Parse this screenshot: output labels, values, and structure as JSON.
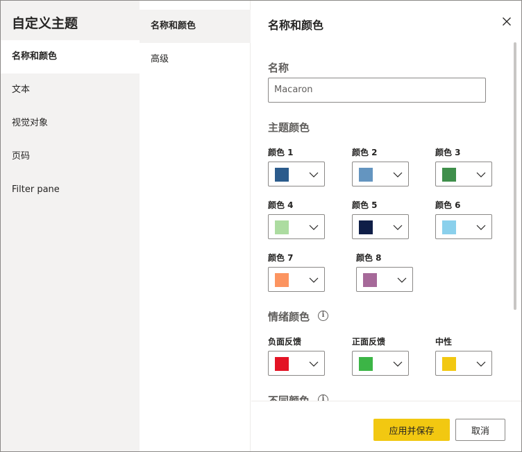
{
  "left_nav": {
    "title": "自定义主题",
    "items": [
      {
        "label": "名称和颜色",
        "active": true
      },
      {
        "label": "文本",
        "active": false
      },
      {
        "label": "视觉对象",
        "active": false
      },
      {
        "label": "页码",
        "active": false
      },
      {
        "label": "Filter pane",
        "active": false
      }
    ]
  },
  "sub_nav": {
    "items": [
      {
        "label": "名称和颜色",
        "active": true
      },
      {
        "label": "高级",
        "active": false
      }
    ]
  },
  "panel": {
    "title": "名称和颜色",
    "close_icon": "close-icon",
    "name_section": {
      "label": "名称",
      "value": "Macaron"
    },
    "theme_colors": {
      "label": "主题颜色",
      "colors": [
        {
          "label": "颜色 1",
          "color": "#2b5b8c"
        },
        {
          "label": "颜色 2",
          "color": "#6495c0"
        },
        {
          "label": "颜色 3",
          "color": "#3f8f4b"
        },
        {
          "label": "颜色 4",
          "color": "#acdca0"
        },
        {
          "label": "颜色 5",
          "color": "#0f1e47"
        },
        {
          "label": "颜色 6",
          "color": "#8ad0ec"
        },
        {
          "label": "颜色 7",
          "color": "#fc9460"
        },
        {
          "label": "颜色 8",
          "color": "#a66999"
        }
      ]
    },
    "sentiment_colors": {
      "label": "情绪颜色",
      "info_icon": "info-icon",
      "colors": [
        {
          "label": "负面反馈",
          "color": "#e31324"
        },
        {
          "label": "正面反馈",
          "color": "#3cb546"
        },
        {
          "label": "中性",
          "color": "#f2c811"
        }
      ]
    },
    "divergent_colors": {
      "label": "不同颜色",
      "info_icon": "info-icon"
    }
  },
  "footer": {
    "apply_label": "应用并保存",
    "cancel_label": "取消",
    "accent_color": "#f2c811"
  }
}
